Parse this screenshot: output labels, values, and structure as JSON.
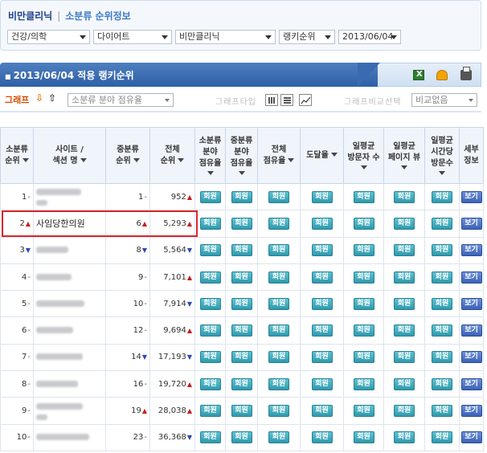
{
  "breadcrumb": {
    "current": "비만클리닉",
    "separator": "|",
    "section": "소분류 순위정보"
  },
  "filters": [
    {
      "value": "건강/의학"
    },
    {
      "value": "다이어트"
    },
    {
      "value": "비만클리닉"
    },
    {
      "value": "랭키순위"
    },
    {
      "value": "2013/06/04"
    }
  ],
  "rank_header": {
    "title": "2013/06/04 적용 랭키순위",
    "bullet": "■",
    "icons": [
      "excel-icon",
      "people-icon",
      "printer-icon"
    ]
  },
  "graph_controls": {
    "label": "그래프",
    "down_arrow": "⇩",
    "up_arrow": "⇧",
    "graph_select": "소분류 분야 점유율",
    "graph_type_label": "그래프타입",
    "compare_label": "그래프비교선택",
    "compare_select": "비교없음"
  },
  "table": {
    "headers": [
      [
        "소분류",
        "순위"
      ],
      [
        "사이트 /",
        "섹션 명"
      ],
      [
        "중분류",
        "순위"
      ],
      [
        "전체",
        "순위"
      ],
      [
        "소분류",
        "분야",
        "점유율"
      ],
      [
        "중분류",
        "분야",
        "점유율"
      ],
      [
        "전체",
        "점유율"
      ],
      [
        "도달율"
      ],
      [
        "일평균",
        "방문자 수"
      ],
      [
        "일평균",
        "페이지 뷰"
      ],
      [
        "일평균",
        "시간당",
        "방문수"
      ],
      [
        "세부",
        "정보"
      ]
    ],
    "member_label": "회원",
    "view_label": "보기",
    "rows": [
      {
        "rank": "1",
        "rank_change": "-",
        "site": "",
        "mid_rank": "1",
        "mid_change": "-",
        "total_rank": "952",
        "total_change": "up"
      },
      {
        "rank": "2",
        "rank_change": "up",
        "site": "사임당한의원",
        "mid_rank": "6",
        "mid_change": "up",
        "total_rank": "5,293",
        "total_change": "up"
      },
      {
        "rank": "3",
        "rank_change": "down",
        "site": "",
        "mid_rank": "8",
        "mid_change": "down",
        "total_rank": "5,564",
        "total_change": "down"
      },
      {
        "rank": "4",
        "rank_change": "-",
        "site": "",
        "mid_rank": "9",
        "mid_change": "-",
        "total_rank": "7,101",
        "total_change": "up"
      },
      {
        "rank": "5",
        "rank_change": "-",
        "site": "",
        "mid_rank": "10",
        "mid_change": "-",
        "total_rank": "7,914",
        "total_change": "down"
      },
      {
        "rank": "6",
        "rank_change": "-",
        "site": "",
        "mid_rank": "12",
        "mid_change": "-",
        "total_rank": "9,694",
        "total_change": "up"
      },
      {
        "rank": "7",
        "rank_change": "-",
        "site": "",
        "mid_rank": "14",
        "mid_change": "down",
        "total_rank": "17,193",
        "total_change": "down"
      },
      {
        "rank": "8",
        "rank_change": "-",
        "site": "",
        "mid_rank": "16",
        "mid_change": "-",
        "total_rank": "19,720",
        "total_change": "up"
      },
      {
        "rank": "9",
        "rank_change": "-",
        "site": "",
        "mid_rank": "19",
        "mid_change": "up",
        "total_rank": "28,038",
        "total_change": "up"
      },
      {
        "rank": "10",
        "rank_change": "-",
        "site": "",
        "mid_rank": "23",
        "mid_change": "-",
        "total_rank": "36,368",
        "total_change": "down"
      }
    ]
  }
}
